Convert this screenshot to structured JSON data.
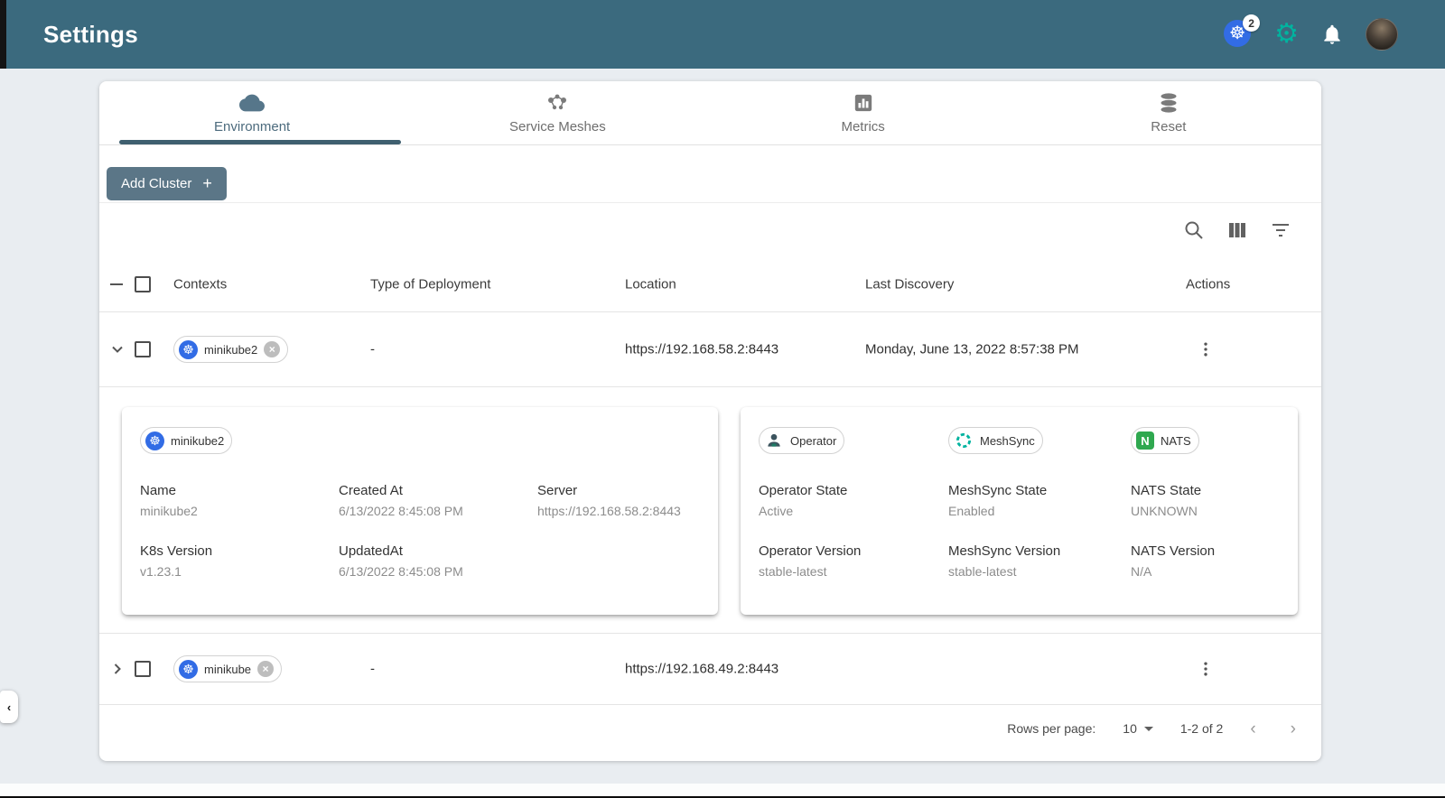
{
  "header": {
    "title": "Settings",
    "kubernetes_badge": "2"
  },
  "tabs": {
    "environment": "Environment",
    "service_meshes": "Service Meshes",
    "metrics": "Metrics",
    "reset": "Reset"
  },
  "toolbar": {
    "add_cluster": "Add Cluster",
    "plus": "+"
  },
  "table": {
    "columns": {
      "contexts": "Contexts",
      "type": "Type of Deployment",
      "location": "Location",
      "last_discovery": "Last Discovery",
      "actions": "Actions"
    },
    "rows": [
      {
        "name": "minikube2",
        "type": "-",
        "location": "https://192.168.58.2:8443",
        "last_discovery": "Monday, June 13, 2022 8:57:38 PM"
      },
      {
        "name": "minikube",
        "type": "-",
        "location": "https://192.168.49.2:8443",
        "last_discovery": ""
      }
    ]
  },
  "detail": {
    "chip": "minikube2",
    "name_label": "Name",
    "name_value": "minikube2",
    "created_label": "Created At",
    "created_value": "6/13/2022 8:45:08 PM",
    "server_label": "Server",
    "server_value": "https://192.168.58.2:8443",
    "k8s_label": "K8s Version",
    "k8s_value": "v1.23.1",
    "updated_label": "UpdatedAt",
    "updated_value": "6/13/2022 8:45:08 PM"
  },
  "operator_card": {
    "operator_chip": "Operator",
    "meshsync_chip": "MeshSync",
    "nats_chip": "NATS",
    "operator_state_label": "Operator State",
    "operator_state_value": "Active",
    "meshsync_state_label": "MeshSync State",
    "meshsync_state_value": "Enabled",
    "nats_state_label": "NATS State",
    "nats_state_value": "UNKNOWN",
    "operator_version_label": "Operator Version",
    "operator_version_value": "stable-latest",
    "meshsync_version_label": "MeshSync Version",
    "meshsync_version_value": "stable-latest",
    "nats_version_label": "NATS Version",
    "nats_version_value": "N/A"
  },
  "pagination": {
    "rows_per_page_label": "Rows per page:",
    "rows_per_page_value": "10",
    "range": "1-2 of 2"
  },
  "icons": {
    "kubernetes": "☸",
    "gear": "⚙",
    "close": "×",
    "chevron_left": "‹",
    "chevron_right": "›"
  },
  "colors": {
    "appbar_teal": "#3b6a7e",
    "accent_teal": "#00B39F",
    "kubernetes_blue": "#326CE5",
    "nats_green": "#2fa84f",
    "button_slate": "#5b7687"
  }
}
